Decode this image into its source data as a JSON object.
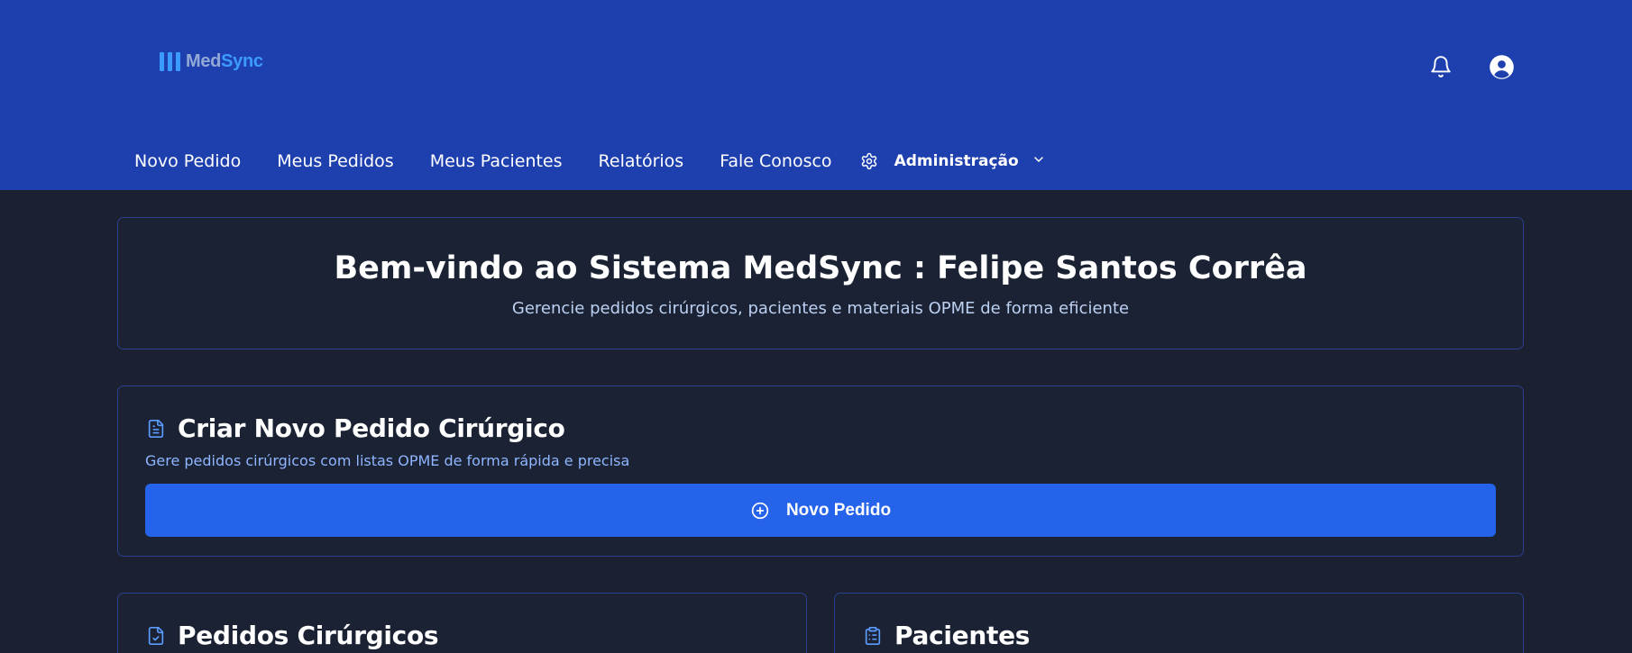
{
  "header": {
    "logo": {
      "part1": "Med",
      "part2": "Sync"
    },
    "icons": {
      "notifications": "bell-icon",
      "account": "user-circle-icon"
    }
  },
  "nav": {
    "items": [
      {
        "label": "Novo Pedido"
      },
      {
        "label": "Meus Pedidos"
      },
      {
        "label": "Meus Pacientes"
      },
      {
        "label": "Relatórios"
      },
      {
        "label": "Fale Conosco"
      }
    ],
    "admin": {
      "label": "Administração",
      "icon": "gear-icon",
      "chevron": "chevron-down-icon"
    }
  },
  "welcome": {
    "title": "Bem-vindo ao Sistema MedSync : Felipe Santos Corrêa",
    "subtitle": "Gerencie pedidos cirúrgicos, pacientes e materiais OPME de forma eficiente"
  },
  "create": {
    "title": "Criar Novo Pedido Cirúrgico",
    "subtitle": "Gere pedidos cirúrgicos com listas OPME de forma rápida e precisa",
    "button_label": "Novo Pedido",
    "icon": "file-text-icon"
  },
  "orders": {
    "title": "Pedidos Cirúrgicos",
    "icon": "file-check-icon"
  },
  "patients": {
    "title": "Pacientes",
    "icon": "clipboard-list-icon"
  },
  "colors": {
    "header_bg": "#1e40af",
    "page_bg": "#1b2130",
    "card_bg": "#1a2233",
    "accent": "#2563eb",
    "logo_blue": "#3b9bff"
  }
}
